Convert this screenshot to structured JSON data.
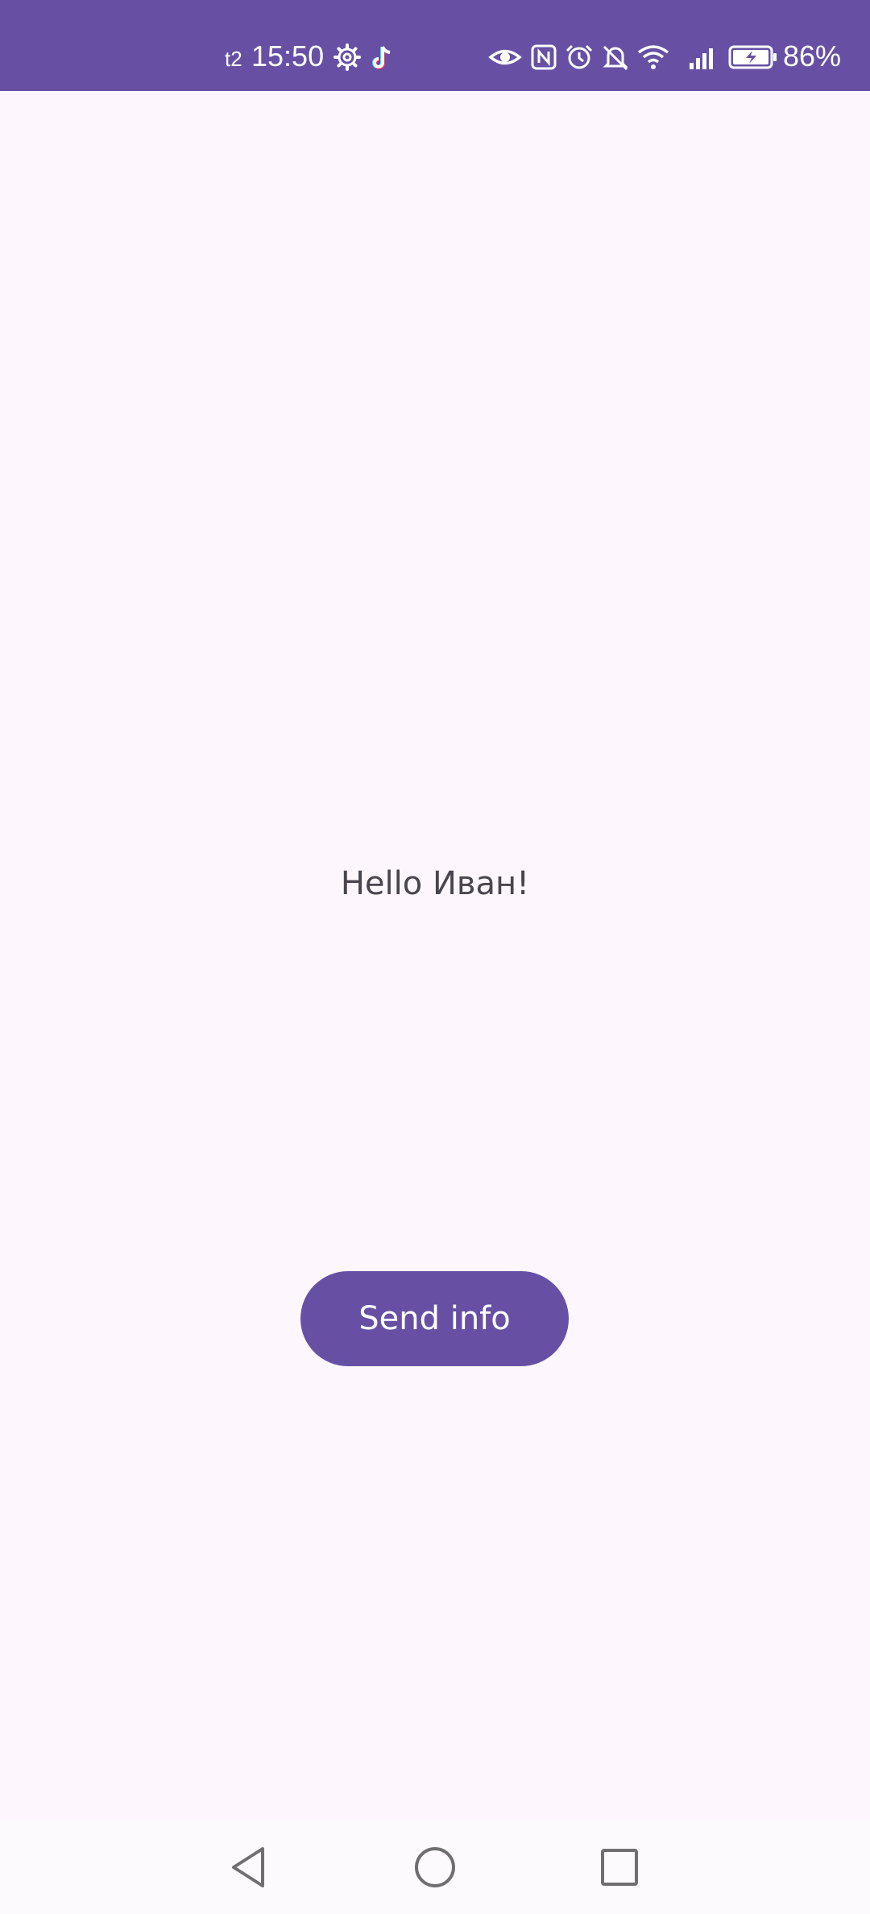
{
  "status_bar": {
    "carrier": "t2",
    "time": "15:50",
    "battery_percent": "86%",
    "color": "#6750a4",
    "icons": [
      "gear-icon",
      "tiktok-icon",
      "eye-icon",
      "nfc-icon",
      "alarm-icon",
      "bell-off-icon",
      "wifi-icon",
      "signal-icon",
      "battery-charging-icon"
    ]
  },
  "main": {
    "greeting": "Hello Иван!",
    "send_button_label": "Send info",
    "accent_color": "#6750a4",
    "background_color": "#fdf7fd"
  },
  "nav_bar": {
    "buttons": [
      "back-icon",
      "home-icon",
      "recents-icon"
    ]
  }
}
